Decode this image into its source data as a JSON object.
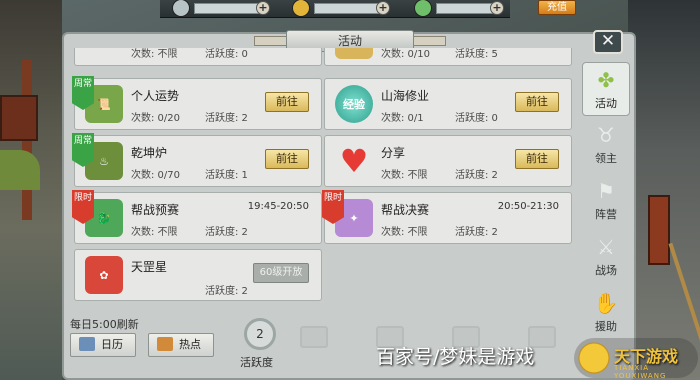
{
  "topbar": {
    "recharge": "充值"
  },
  "panel": {
    "title": "活动",
    "close": "✕"
  },
  "partial_cards": [
    {
      "count": "次数: 不限",
      "active": "活跃度: 0"
    },
    {
      "count": "次数: 0/10",
      "active": "活跃度: 5"
    }
  ],
  "cards": [
    {
      "name": "个人运势",
      "ribbon": "周常",
      "ribbon_color": "green",
      "count": "次数: 0/20",
      "active": "活跃度: 2",
      "button": "前往",
      "icon": "scroll-icon",
      "icon_color": "#7aa64a"
    },
    {
      "name": "山海修业",
      "ribbon": "",
      "count": "次数: 0/1",
      "active": "活跃度: 0",
      "button": "前往",
      "icon": "jingyan-icon",
      "icon_text": "经验",
      "icon_color": "#3fb3a2"
    },
    {
      "name": "乾坤炉",
      "ribbon": "周常",
      "ribbon_color": "green",
      "count": "次数: 0/70",
      "active": "活跃度: 1",
      "button": "前往",
      "icon": "cauldron-icon",
      "icon_color": "#6d8f3c"
    },
    {
      "name": "分享",
      "ribbon": "",
      "count": "次数: 不限",
      "active": "活跃度: 2",
      "button": "前往",
      "icon": "heart-icon",
      "icon_color": "#e53b34"
    },
    {
      "name": "帮战预赛",
      "ribbon": "限时",
      "ribbon_color": "red",
      "time": "19:45-20:50",
      "count": "次数: 不限",
      "active": "活跃度: 2",
      "icon": "dragon-icon",
      "icon_color": "#4fa85a"
    },
    {
      "name": "帮战决赛",
      "ribbon": "限时",
      "ribbon_color": "red",
      "time": "20:50-21:30",
      "count": "次数: 不限",
      "active": "活跃度: 2",
      "icon": "orb-icon",
      "icon_color": "#b78ad6"
    },
    {
      "name": "天罡星",
      "ribbon": "",
      "count": "",
      "active": "活跃度: 2",
      "locked": "60级开放",
      "icon": "charm-icon",
      "icon_color": "#d9473b"
    }
  ],
  "tabs": [
    {
      "label": "活动",
      "icon": "clover-icon",
      "active": true
    },
    {
      "label": "领主",
      "icon": "ox-head-icon"
    },
    {
      "label": "阵营",
      "icon": "flag-icon"
    },
    {
      "label": "战场",
      "icon": "crossed-swords-icon"
    },
    {
      "label": "援助",
      "icon": "helping-hand-icon"
    }
  ],
  "bottom": {
    "refresh": "每日5:00刷新",
    "calendar": "日历",
    "hot": "热点",
    "activity_value": "2",
    "activity_label": "活跃度"
  },
  "watermark": "百家号/梦妹是游戏",
  "logo": {
    "text": "天下游戏",
    "sub": "TIANXIA YOUXIWANG"
  }
}
